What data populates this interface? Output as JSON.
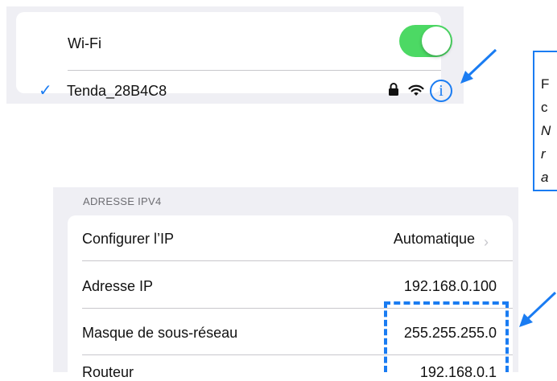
{
  "wifi": {
    "label": "Wi-Fi",
    "toggle_on": true,
    "network": {
      "name": "Tenda_28B4C8",
      "connected_check": "✓",
      "info_symbol": "i"
    }
  },
  "ipv4": {
    "header": "ADRESSE IPV4",
    "rows": [
      {
        "label": "Configurer l’IP",
        "value": "Automatique",
        "chevron": "›"
      },
      {
        "label": "Adresse IP",
        "value": "192.168.0.100"
      },
      {
        "label": "Masque de sous-réseau",
        "value": "255.255.255.0"
      },
      {
        "label": "Routeur",
        "value": "192.168.0.1"
      }
    ]
  },
  "callout": {
    "lines": [
      "F",
      "c",
      "N",
      "r",
      "a"
    ]
  },
  "colors": {
    "accent": "#1a7cf2",
    "toggle_on": "#4cd964",
    "grouped_bg": "#efeff4",
    "separator": "#c8c7cc"
  }
}
